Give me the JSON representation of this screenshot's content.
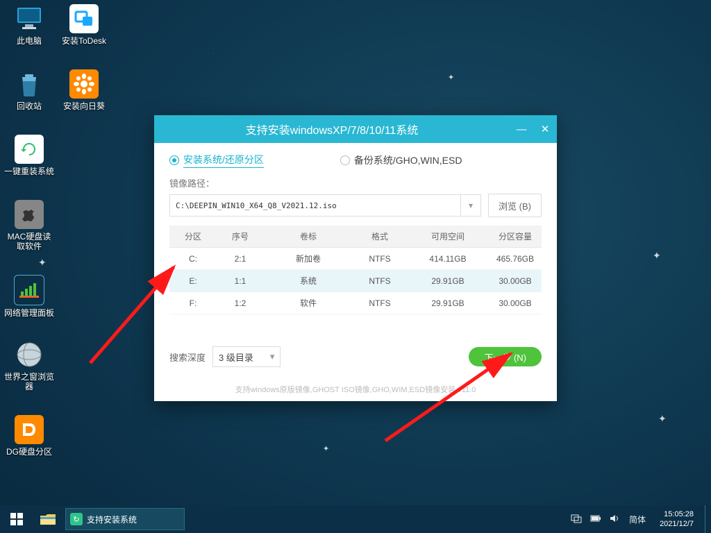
{
  "desktop_icons": [
    {
      "label": "此电脑"
    },
    {
      "label": "安装ToDesk"
    },
    {
      "label": "回收站"
    },
    {
      "label": "安装向日葵"
    },
    {
      "label": "一键重装系统"
    },
    {
      "label": "MAC硬盘读取软件"
    },
    {
      "label": "网络管理面板"
    },
    {
      "label": "世界之窗浏览器"
    },
    {
      "label": "DG硬盘分区"
    }
  ],
  "window": {
    "title": "支持安装windowsXP/7/8/10/11系统",
    "tab_install": "安装系统/还原分区",
    "tab_backup": "备份系统/GHO,WIN,ESD",
    "path_label": "镜像路径：",
    "path_value": "C:\\DEEPIN_WIN10_X64_Q8_V2021.12.iso",
    "browse_btn": "浏览 (B)",
    "columns": {
      "part": "分区",
      "index": "序号",
      "vol": "卷标",
      "fmt": "格式",
      "free": "可用空间",
      "cap": "分区容量"
    },
    "rows": [
      {
        "part": "C:",
        "index": "2:1",
        "vol": "新加卷",
        "fmt": "NTFS",
        "free": "414.11GB",
        "cap": "465.76GB"
      },
      {
        "part": "E:",
        "index": "1:1",
        "vol": "系统",
        "fmt": "NTFS",
        "free": "29.91GB",
        "cap": "30.00GB"
      },
      {
        "part": "F:",
        "index": "1:2",
        "vol": "软件",
        "fmt": "NTFS",
        "free": "29.91GB",
        "cap": "30.00GB"
      }
    ],
    "search_depth_label": "搜索深度",
    "search_depth_value": "3 级目录",
    "next_btn": "下一步 (N)",
    "foot_note": "支持windows原版镜像,GHOST ISO镜像,GHO,WIM,ESD镜像安装  v11.0"
  },
  "taskbar": {
    "task_label": "支持安装系统",
    "ime": "简体",
    "time": "15:05:28",
    "date": "2021/12/7"
  }
}
